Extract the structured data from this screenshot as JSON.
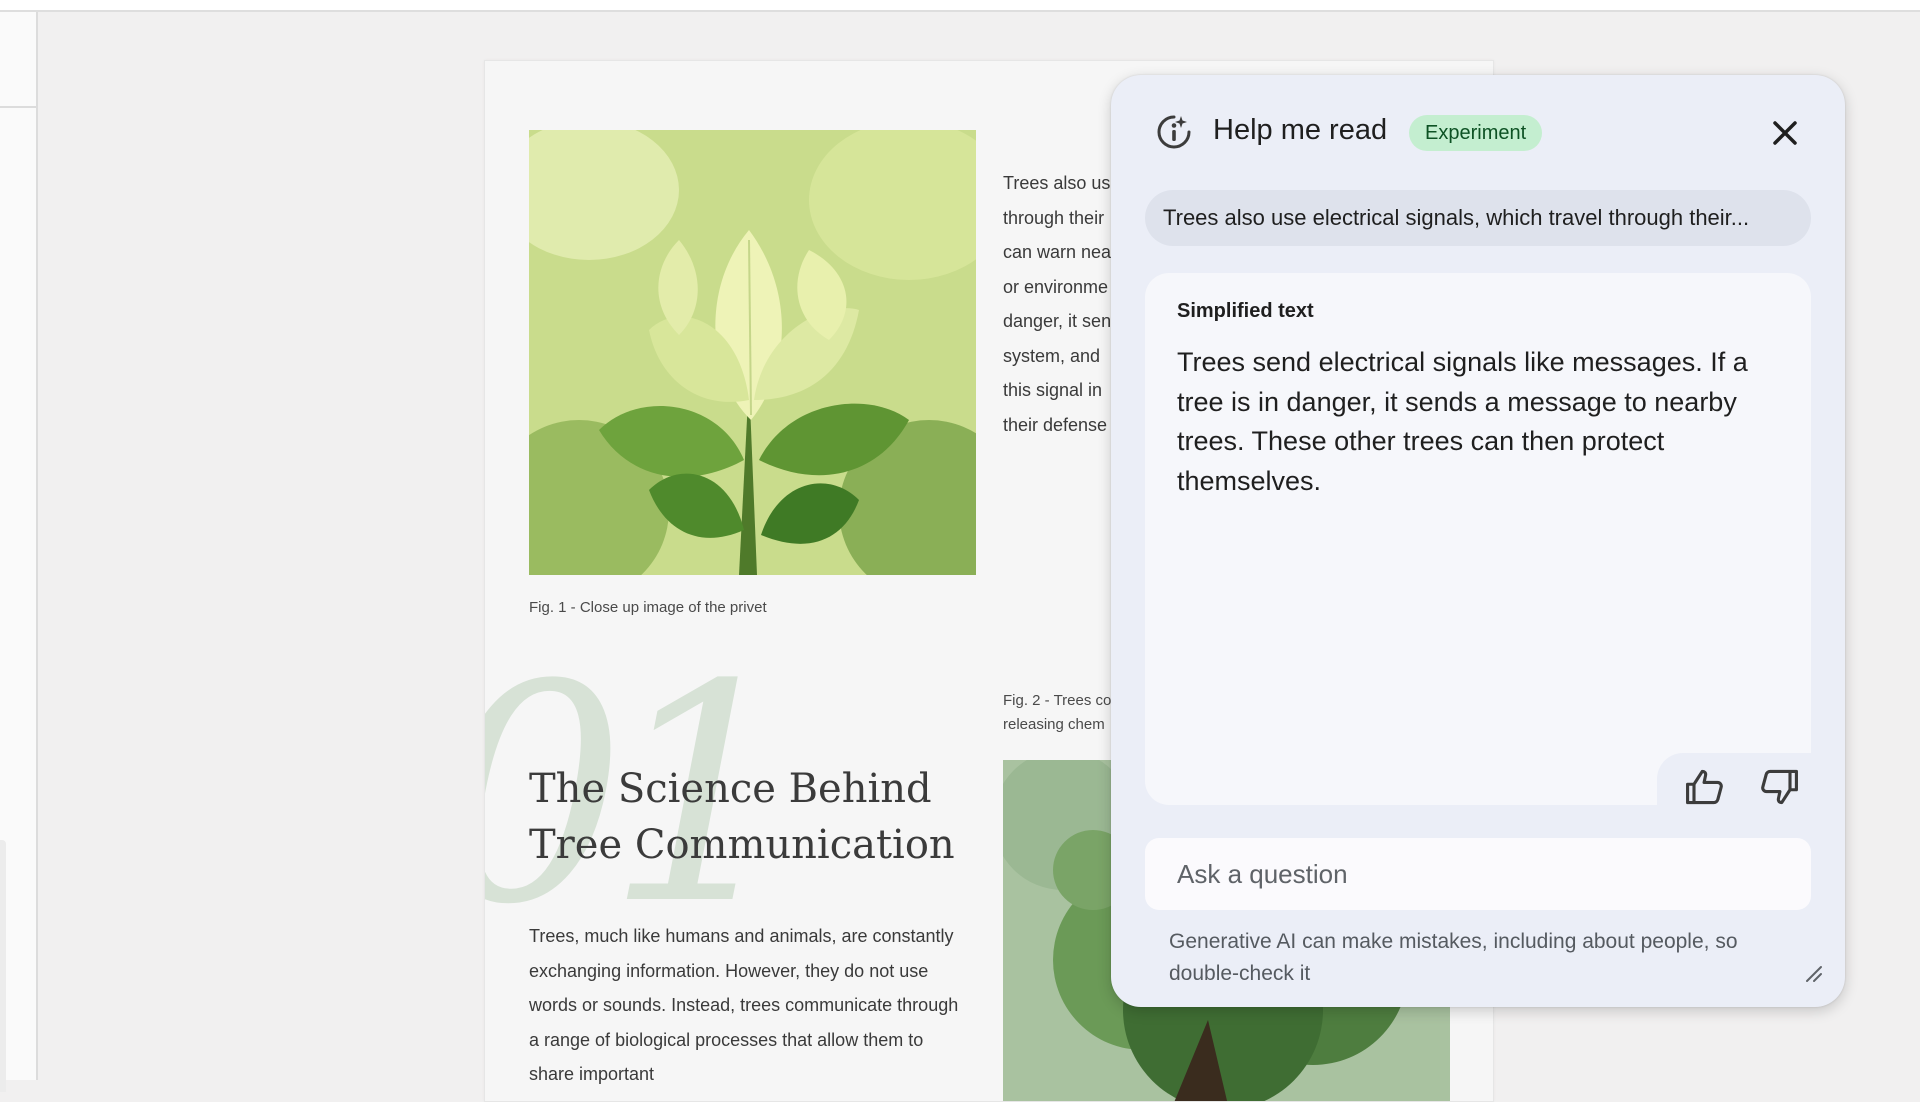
{
  "document": {
    "fig1_caption": "Fig. 1 - Close up image of the privet",
    "body_lines": [
      "Trees also us",
      "through their",
      "can warn nea",
      "or environme",
      "danger, it sen",
      "system, and",
      "this signal in",
      "their defense"
    ],
    "section_number": "01",
    "section_title": "The Science Behind Tree Communication",
    "section_body": "Trees, much like humans and animals, are constantly exchanging information. However, they do not use words or sounds. Instead, trees communicate through a range of biological processes that allow them to share important",
    "fig2_caption_lines": [
      "Fig. 2 - Trees co",
      "releasing chem"
    ]
  },
  "panel": {
    "title": "Help me read",
    "badge": "Experiment",
    "quote": "Trees also use electrical signals, which travel through their...",
    "result_label": "Simplified text",
    "result_text": "Trees send electrical signals like messages. If a tree is in danger, it sends a message to nearby trees. These other trees can then protect themselves.",
    "ask_placeholder": "Ask a question",
    "disclaimer": "Generative AI can make mistakes, including about people, so double-check it"
  }
}
